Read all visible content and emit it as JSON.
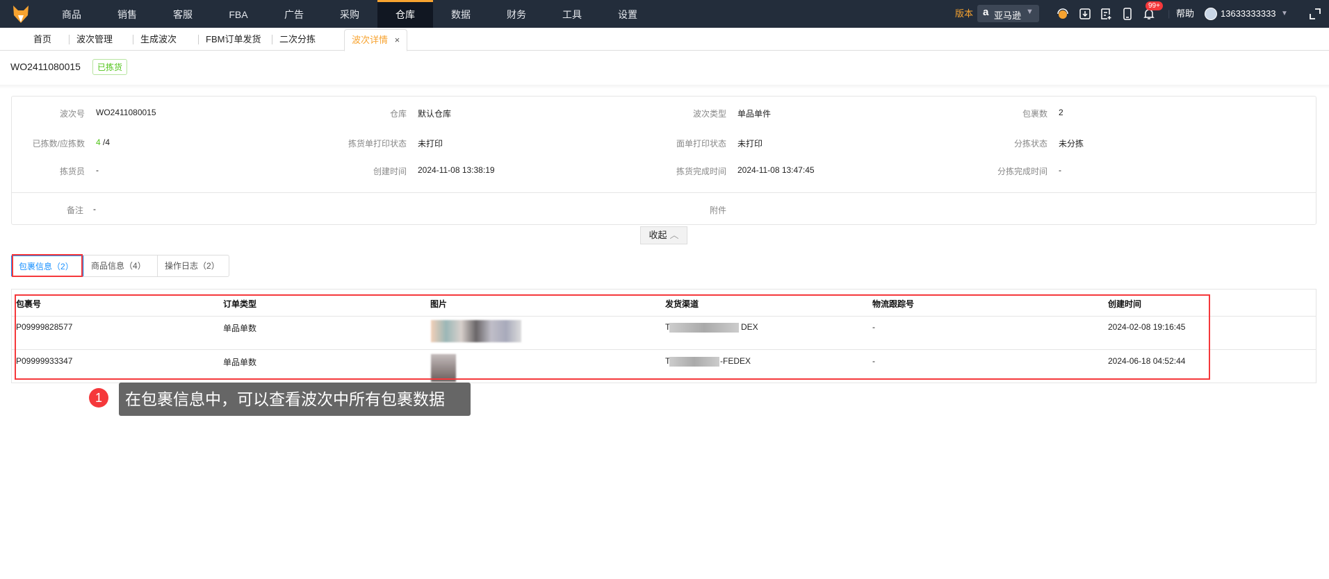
{
  "topnav": {
    "items": [
      "商品",
      "销售",
      "客服",
      "FBA",
      "广告",
      "采购",
      "仓库",
      "数据",
      "财务",
      "工具",
      "设置"
    ],
    "active": "仓库",
    "version_label": "版本",
    "platform": "亚马逊",
    "notification_badge": "99+",
    "help_label": "帮助",
    "user_phone": "13633333333",
    "icons": [
      "headset-icon",
      "download-icon",
      "add-document-icon",
      "mobile-icon",
      "bell-icon",
      "fullscreen-icon"
    ]
  },
  "pagetabs": {
    "items": [
      "首页",
      "波次管理",
      "生成波次",
      "FBM订单发货",
      "二次分拣"
    ],
    "active": "波次详情",
    "close": "×"
  },
  "header": {
    "wave_no": "WO2411080015",
    "status": "已拣货"
  },
  "info": {
    "fields": [
      {
        "label": "波次号",
        "value": "WO2411080015"
      },
      {
        "label": "仓库",
        "value": "默认仓库"
      },
      {
        "label": "波次类型",
        "value": "单品单件"
      },
      {
        "label": "包裹数",
        "value": "2"
      },
      {
        "label": "已拣数/应拣数",
        "value": "4",
        "value2": "/4"
      },
      {
        "label": "拣货单打印状态",
        "value": "未打印"
      },
      {
        "label": "面单打印状态",
        "value": "未打印"
      },
      {
        "label": "分拣状态",
        "value": "未分拣"
      },
      {
        "label": "拣货员",
        "value": "-"
      },
      {
        "label": "创建时间",
        "value": "2024-11-08 13:38:19"
      },
      {
        "label": "拣货完成时间",
        "value": "2024-11-08 13:47:45"
      },
      {
        "label": "分拣完成时间",
        "value": "-"
      }
    ],
    "remark_label": "备注",
    "remark_value": "-",
    "attachment_label": "附件",
    "collapse_label": "收起",
    "collapse_icon": "chevron-up-icon"
  },
  "subtabs": [
    {
      "label": "包裹信息",
      "count": "（2）"
    },
    {
      "label": "商品信息",
      "count": "（4）"
    },
    {
      "label": "操作日志",
      "count": "（2）"
    }
  ],
  "table": {
    "columns": [
      "包裹号",
      "订单类型",
      "图片",
      "发货渠道",
      "物流跟踪号",
      "创建时间"
    ],
    "rows": [
      {
        "package_no": "P09999828577",
        "order_type": "单品单数",
        "channel_prefix": "Te",
        "channel_suffix": "DEX",
        "tracking": "-",
        "created": "2024-02-08 19:16:45"
      },
      {
        "package_no": "P09999933347",
        "order_type": "单品单数",
        "channel_prefix": "Te",
        "channel_suffix": "-FEDEX",
        "tracking": "-",
        "created": "2024-06-18 04:52:44"
      }
    ]
  },
  "annotation": {
    "step": "1",
    "text": "在包裹信息中，可以查看波次中所有包裹数据"
  },
  "colors": {
    "nav_bg": "#232d3b",
    "accent": "#f7a330",
    "link_blue": "#1890ff",
    "success_green": "#52c41a",
    "highlight_red": "#f5383b",
    "tooltip_bg": "#666666"
  }
}
